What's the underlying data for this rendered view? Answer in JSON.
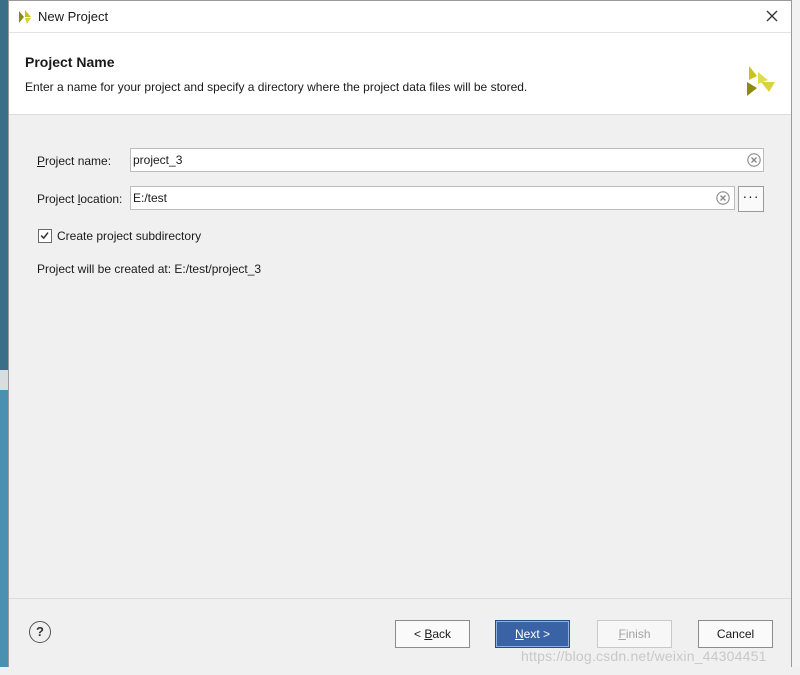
{
  "window": {
    "title": "New Project",
    "close_icon": "close-icon",
    "app_icon": "xilinx-logo-icon"
  },
  "header": {
    "title": "Project Name",
    "description": "Enter a name for your project and specify a directory where the project data files will be stored.",
    "logo": "xilinx-logo-icon"
  },
  "form": {
    "project_name": {
      "label_accel": "P",
      "label_rest": "roject name:",
      "value": "project_3"
    },
    "project_location": {
      "label_before": "Project ",
      "label_accel": "l",
      "label_after": "ocation:",
      "value": "E:/test",
      "browse_label": "···"
    },
    "create_subdirectory": {
      "label": "Create project subdirectory",
      "checked": true
    },
    "created_at_text": "Project will be created at: E:/test/project_3"
  },
  "footer": {
    "help_label": "?",
    "back": {
      "prefix": "< ",
      "accel": "B",
      "rest": "ack"
    },
    "next": {
      "accel": "N",
      "rest": "ext >"
    },
    "finish": {
      "accel": "F",
      "rest": "inish"
    },
    "cancel": "Cancel"
  },
  "watermark": "https://blog.csdn.net/weixin_44304451",
  "colors": {
    "primary_button": "#3a63a5",
    "logo_yellow": "#c9c21a",
    "logo_olive": "#8c8a12"
  }
}
